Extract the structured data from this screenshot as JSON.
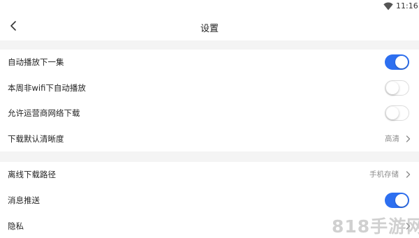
{
  "status_bar": {
    "time": "11:16",
    "icons": [
      "wifi-icon"
    ]
  },
  "header": {
    "title": "设置",
    "back_icon": "chevron-left-icon"
  },
  "colors": {
    "accent": "#2d6ff0",
    "section_gap": "#f4f4f4",
    "value_text": "#8e8e8e"
  },
  "settings": [
    {
      "label": "自动播放下一集",
      "control": "toggle",
      "on": true
    },
    {
      "label": "本周非wifi下自动播放",
      "control": "toggle",
      "on": false
    },
    {
      "label": "允许运营商网络下载",
      "control": "toggle",
      "on": false
    },
    {
      "label": "下载默认清晰度",
      "control": "select",
      "value": "高清"
    },
    {
      "label": "离线下载路径",
      "control": "select",
      "value": "手机存储"
    },
    {
      "label": "消息推送",
      "control": "toggle",
      "on": true
    },
    {
      "label": "隐私",
      "control": "link"
    }
  ],
  "watermark": "818手游网"
}
